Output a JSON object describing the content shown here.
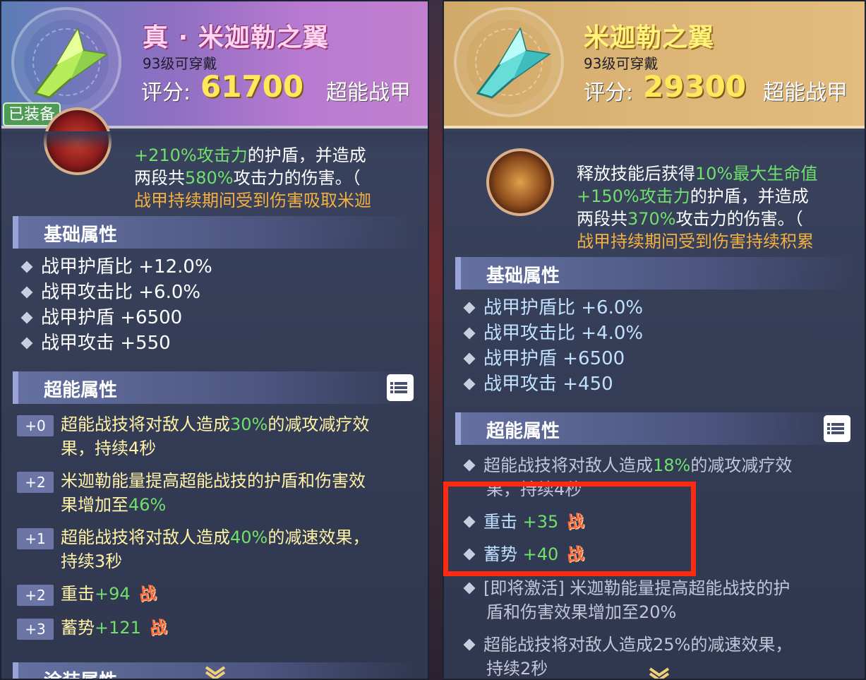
{
  "left": {
    "title": "真 · 米迦勒之翼",
    "level_req": "93级可穿戴",
    "score_label": "评分:",
    "score_value": "61700",
    "type": "超能战甲",
    "equipped_badge": "已装备",
    "skill_desc": {
      "line1_a": "+210%攻击力",
      "line1_b": "的护盾，并造成",
      "line2_a": "两段共",
      "line2_b": "580%",
      "line2_c": "攻击力的伤害。（",
      "line3": "战甲持续期间受到伤害吸取米迦"
    },
    "base_title": "基础属性",
    "base_attrs": [
      "战甲护盾比 +12.0%",
      "战甲攻击比 +6.0%",
      "战甲护盾 +6500",
      "战甲攻击 +550"
    ],
    "super_title": "超能属性",
    "super_attrs": [
      {
        "badge": "+0",
        "a": "超能战技将对敌人造成",
        "b": "30%",
        "c": "的减攻减疗效",
        "d": "果，持续4秒"
      },
      {
        "badge": "+2",
        "a": "米迦勒能量提高超能战技的护盾和伤害效",
        "d1": "果增加至",
        "d2": "46%"
      },
      {
        "badge": "+1",
        "a": "超能战技将对敌人造成",
        "b": "40%",
        "c": "的减速效果，",
        "d": "持续3秒"
      },
      {
        "badge": "+2",
        "name": "重击",
        "value": "+94",
        "tag": "战"
      },
      {
        "badge": "+3",
        "name": "蓄势",
        "value": "+121",
        "tag": "战"
      }
    ],
    "next_section": "涂装属性"
  },
  "right": {
    "title": "米迦勒之翼",
    "level_req": "93级可穿戴",
    "score_label": "评分:",
    "score_value": "29300",
    "type": "超能战甲",
    "skill_desc": {
      "line1_a": "释放技能后获得",
      "line1_b": "10%最大生命值",
      "line2_a": "+150%攻击力",
      "line2_b": "的护盾，并造成",
      "line3_a": "两段共",
      "line3_b": "370%",
      "line3_c": "攻击力的伤害。（",
      "line4": "战甲持续期间受到伤害持续积累"
    },
    "base_title": "基础属性",
    "base_attrs": [
      "战甲护盾比 +6.0%",
      "战甲攻击比 +4.0%",
      "战甲护盾 +6500",
      "战甲攻击 +450"
    ],
    "super_title": "超能属性",
    "super_attrs": {
      "s1_a": "超能战技将对敌人造成",
      "s1_b": "18%",
      "s1_c": "的减攻减疗效",
      "s1_d": "果，持续4秒",
      "s2_name": "重击",
      "s2_value": "+35",
      "s3_name": "蓄势",
      "s3_value": "+40",
      "tag": "战",
      "s4_a": "[即将激活]  米迦勒能量提高超能战技的护",
      "s4_b": "盾和伤害效果增加至20%",
      "s5_a": "超能战技将对敌人造成25%的减速效果，",
      "s5_b": "持续2秒"
    }
  },
  "colors": {
    "highlight_box": "#ff2a12",
    "green": "#6fe06a",
    "orange": "#f2b040",
    "yellow": "#fff2a6"
  },
  "icons": [
    "wing-icon",
    "skill-emblem-icon",
    "list-icon",
    "chevron-down-icon",
    "diamond-bullet-icon"
  ]
}
